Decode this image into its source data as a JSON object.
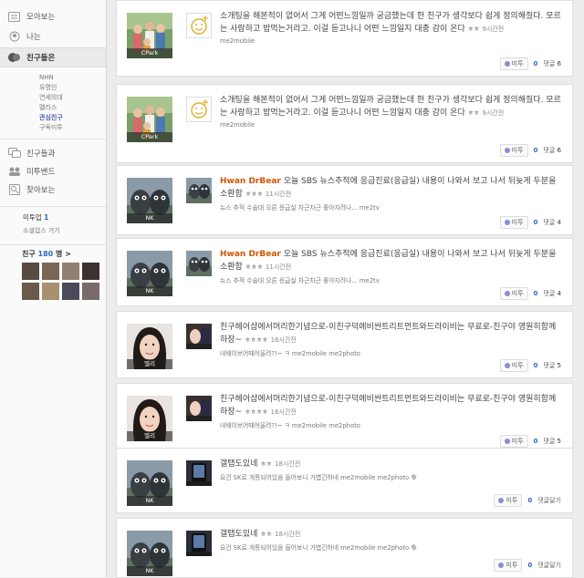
{
  "sidebar": {
    "nav": [
      {
        "label": "모아보는",
        "icon": "home-icon"
      },
      {
        "label": "나는",
        "icon": "person-icon"
      },
      {
        "label": "친구들은",
        "icon": "friends-icon",
        "active": true
      }
    ],
    "sub_items": [
      "NHN",
      "유명인",
      "연세의대",
      "멜리스",
      "관심친구",
      "구독미투"
    ],
    "selected_sub": 4,
    "nav2": [
      {
        "label": "친구들과",
        "icon": "chat-icon"
      },
      {
        "label": "미투밴드",
        "icon": "band-icon"
      },
      {
        "label": "찾아보는",
        "icon": "magnifier-icon"
      }
    ],
    "me2up": {
      "label": "미투업",
      "count": "1",
      "sub": "소셜업스 가기"
    },
    "friends": {
      "label": "친구",
      "count": "180",
      "unit": "명",
      "arrow": ">"
    }
  },
  "posts": [
    {
      "avatar_name": "CPark",
      "avatar_kind": "family",
      "icon": "smiley",
      "author": "",
      "text": "소개팅을 해본적이 없어서 그게 어떤느낌일까 궁금했는데 한 친구가 생각보다 쉽게 정의해줬다. 모르는 사람하고 밥먹는거라고. 이걸 듣고나니 어떤 느낌일지 대충 감이 온다",
      "emo": "ㅎㅎ",
      "time": "9시간전",
      "meta": "me2mobile",
      "metoo_label": "미투",
      "metoo_count": "0",
      "comment_label": "댓글",
      "comment_count": "6"
    },
    {
      "avatar_name": "CPark",
      "avatar_kind": "family",
      "icon": "smiley",
      "author": "",
      "text": "소개팅을 해본적이 없어서 그게 어떤느낌일까 궁금했는데 한 친구가 생각보다 쉽게 정의해줬다. 모르는 사람하고 밥먹는거라고. 이걸 듣고나니 어떤 느낌일지 대충 감이 온다",
      "emo": "ㅎㅎ",
      "time": "9시간전",
      "meta": "me2mobile",
      "metoo_label": "미투",
      "metoo_count": "0",
      "comment_label": "댓글",
      "comment_count": "6"
    },
    {
      "avatar_name": "NK",
      "avatar_kind": "statues",
      "icon": "statues",
      "author": "Hwan DrBear",
      "text": "오늘 SBS 뉴스추적에 응급진료(응급실) 내용이 나와서 보고 나서 뒤늦게 두분을 소환함",
      "emo": "ㅎㅎㅎ",
      "time": "11시간전",
      "meta": "뉴스 추적 수술대 오른 응급실 차근차근 좋아지려나...   me2tv",
      "metoo_label": "미투",
      "metoo_count": "0",
      "comment_label": "댓글",
      "comment_count": "4"
    },
    {
      "avatar_name": "NK",
      "avatar_kind": "statues",
      "icon": "statues",
      "author": "Hwan DrBear",
      "text": "오늘 SBS 뉴스추적에 응급진료(응급실) 내용이 나와서 보고 나서 뒤늦게 두분을 소환함",
      "emo": "ㅎㅎㅎ",
      "time": "11시간전",
      "meta": "뉴스 추적 수술대 오른 응급실 차근차근 좋아지려나...   me2tv",
      "metoo_label": "미투",
      "metoo_count": "0",
      "comment_label": "댓글",
      "comment_count": "4"
    },
    {
      "avatar_name": "엘리",
      "avatar_kind": "woman",
      "icon": "woman",
      "author": "",
      "text": "친구헤어샵에서머리한기념으로-이친구덕에비싼트리트먼트와드라이비는 무료로-친구야 영원히함께하장~",
      "emo": "ㅎㅎㅎㅎ",
      "time": "16시간전",
      "meta": "내웨이브어때어울려?!~ ㅋ   me2mobile me2photo",
      "metoo_label": "미투",
      "metoo_count": "0",
      "comment_label": "댓글",
      "comment_count": "5"
    },
    {
      "avatar_name": "엘리",
      "avatar_kind": "woman",
      "icon": "woman",
      "author": "",
      "text": "친구헤어샵에서머리한기념으로-이친구덕에비싼트리트먼트와드라이비는 무료로-친구야 영원히함께하장~",
      "emo": "ㅎㅎㅎㅎ",
      "time": "16시간전",
      "meta": "내웨이브어때어울려?!~ ㅋ   me2mobile me2photo",
      "metoo_label": "미투",
      "metoo_count": "0",
      "comment_label": "댓글",
      "comment_count": "5"
    },
    {
      "avatar_name": "NK",
      "avatar_kind": "statues",
      "icon": "phone",
      "author": "",
      "text": "갤탭도있네",
      "emo": "ㅎㅎ",
      "time": "18시간전",
      "meta": "요건 SK로 개통되어있음 들어보니 가볍긴하네   me2mobile me2photo",
      "pin": true,
      "metoo_label": "미투",
      "metoo_count": "0",
      "comment_label": "댓글달기",
      "comment_count": ""
    },
    {
      "avatar_name": "NK",
      "avatar_kind": "statues",
      "icon": "phone",
      "author": "",
      "text": "갤탭도있네",
      "emo": "ㅎㅎ",
      "time": "18시간전",
      "meta": "요건 SK로 개통되어있음 들어보니 가볍긴하네   me2mobile me2photo",
      "pin": true,
      "metoo_label": "미투",
      "metoo_count": "0",
      "comment_label": "댓글달기",
      "comment_count": ""
    }
  ]
}
